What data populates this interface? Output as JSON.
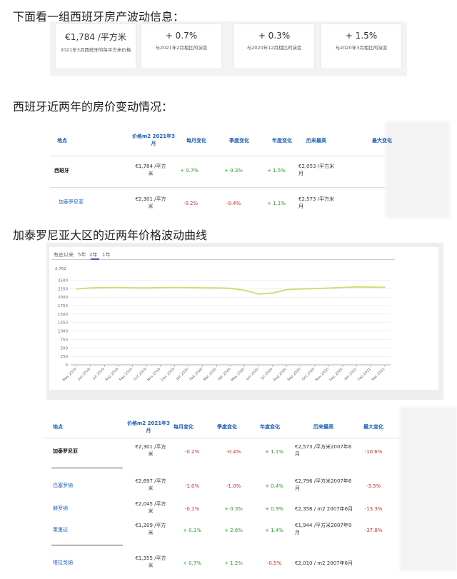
{
  "headings": {
    "h1": "下面看一组西班牙房产波动信息：",
    "h2": "西班牙近两年的房价变动情况：",
    "h3": "加泰罗尼亚大区的近两年价格波动曲线"
  },
  "cards": [
    {
      "value": "€1,784 /平方米",
      "desc": "2021年3月西班牙的每平方米价格"
    },
    {
      "value": "+ 0.7%",
      "desc": "与2021年2月相比的演变"
    },
    {
      "value": "+ 0.3%",
      "desc": "与2020年12月相比的演变"
    },
    {
      "value": "+ 1.5%",
      "desc": "与2020年3月相比的演变"
    }
  ],
  "table1": {
    "headers": {
      "loc": "地点",
      "price": "价格m2 2021年3月",
      "month": "每月变化",
      "quarter": "季度变化",
      "year": "年度变化",
      "max": "历来最高",
      "maxchg": "最大变化"
    },
    "rows": [
      {
        "loc": "西班牙",
        "price": "€1,784 /平方米",
        "month": "+ 0.7%",
        "quarter": "+ 0.3%",
        "year": "+ 1.5%",
        "max": "€2,053 /平方米 月"
      },
      {
        "loc": "加泰罗尼亚",
        "price": "€2,301 /平方米",
        "month": "-0.2%",
        "quarter": "-0.4%",
        "year": "+ 1.1%",
        "max": "€2,573 /平方米 月"
      }
    ]
  },
  "chart": {
    "tabs": [
      "有史以来",
      "5年",
      "2年",
      "1年"
    ],
    "active_tab": "2年",
    "ymax_label": "2,762"
  },
  "chart_data": {
    "type": "line",
    "x": [
      "May 2019",
      "Jun 2019",
      "Jul 2019",
      "Aug 2019",
      "Sep 2019",
      "Oct 2019",
      "Nov 2019",
      "Dec 2019",
      "Jan 2020",
      "Feb 2020",
      "Mar 2020",
      "Apr 2020",
      "May 2020",
      "Jun 2020",
      "Jul 2020",
      "Aug 2020",
      "Sep 2020",
      "Oct 2020",
      "Nov 2020",
      "Dec 2020",
      "Jan 2021",
      "Feb 2021",
      "Mar 2021"
    ],
    "x_tick_labels": [
      "May 2019",
      "Jun 2019",
      "Jul 2019",
      "Aug 2019",
      "Sep 2019",
      "Oct 2019",
      "Nov 2019",
      "Dec 2019",
      "Jan 2020",
      "Feb 2020",
      "Mar 2020",
      "Apr 2020",
      "May 2020",
      "Jun 2020",
      "Jul 2020",
      "Aug 2020",
      "Sep 2020",
      "Oct 2020",
      "Nov 2020",
      "Dec 2020",
      "Jan 2021",
      "Feb 2021",
      "Mar 2021"
    ],
    "y_ticks": [
      0,
      250,
      500,
      750,
      1000,
      1250,
      1500,
      1750,
      2000,
      2250,
      2500
    ],
    "ylim": [
      0,
      2762
    ],
    "series": [
      {
        "values": [
          2240,
          2270,
          2280,
          2285,
          2275,
          2270,
          2280,
          2285,
          2280,
          2275,
          2270,
          2260,
          2200,
          2090,
          2120,
          2220,
          2240,
          2250,
          2265,
          2285,
          2300,
          2295,
          2290
        ],
        "color": "#c8dc6a"
      }
    ],
    "grid": true
  },
  "table2": {
    "headers": {
      "loc": "地点",
      "price": "价格m2 2021年3月",
      "month": "每月变化",
      "quarter": "季度变化",
      "year": "年度变化",
      "max": "历来最高",
      "maxchg": "最大变化"
    },
    "rows": [
      {
        "loc": "加泰罗尼亚",
        "price": "€2,301 /平方米",
        "month": "-0.2%",
        "quarter": "-0.4%",
        "year": "+ 1.1%",
        "max": "€2,573 /平方米2007年6月",
        "maxchg": "-10.6%"
      },
      {
        "loc": "巴塞罗纳",
        "price": "€2,697 /平方米",
        "month": "-1.0%",
        "quarter": "-1.0%",
        "year": "+ 0.4%",
        "max": "€2,796 /平方米2007年6月",
        "maxchg": "-3.5%"
      },
      {
        "loc": "赫罗纳",
        "price": "€2,045 /平方米",
        "month": "-0.1%",
        "quarter": "+ 0.3%",
        "year": "+ 0.9%",
        "max": "€2,358 / m2 2007年6月",
        "maxchg": "-13.3%"
      },
      {
        "loc": "莱里达",
        "price": "€1,209 /平方米",
        "month": "+ 0.1%",
        "quarter": "+ 2.6%",
        "year": "+ 1.4%",
        "max": "€1,944 /平方米2007年9月",
        "maxchg": "-37.8%"
      },
      {
        "loc": "塔拉戈纳",
        "price": "€1,355 /平方米",
        "month": "+ 0.7%",
        "quarter": "+ 1.2%",
        "year": "-0.5%",
        "max": "€2,010 / m2 2007年6月",
        "maxchg": ""
      }
    ]
  }
}
